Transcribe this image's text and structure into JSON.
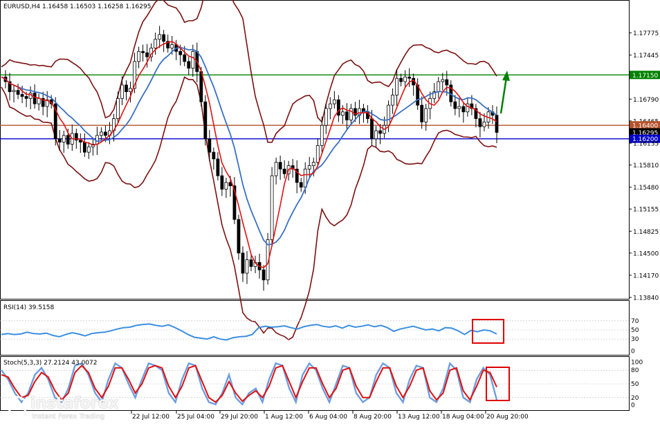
{
  "header": {
    "symbol_info": "EURUSD,H4  1.16458 1.16503 1.16258 1.16295"
  },
  "chart_data": {
    "type": "candlestick",
    "symbol": "EURUSD",
    "timeframe": "H4",
    "ohlc": {
      "open": 1.16458,
      "high": 1.16503,
      "low": 1.16258,
      "close": 1.16295
    },
    "ylim": [
      1.1384,
      1.181
    ],
    "y_ticks": [
      "1.17775",
      "1.17445",
      "1.17150",
      "1.16790",
      "1.16465",
      "1.16400",
      "1.16295",
      "1.16200",
      "1.16135",
      "1.15810",
      "1.15480",
      "1.15155",
      "1.14825",
      "1.14500",
      "1.14170",
      "1.13840"
    ],
    "x_ticks": [
      "22 Jul 12:00",
      "25 Jul 04:00",
      "29 Jul 20:00",
      "1 Aug 12:00",
      "6 Aug 04:00",
      "8 Aug 20:00",
      "13 Aug 12:00",
      "18 Aug 04:00",
      "20 Aug 20:00"
    ],
    "horizontal_levels": [
      {
        "price": 1.1715,
        "label": "1.17150",
        "color": "#008000"
      },
      {
        "price": 1.164,
        "label": "1.16400",
        "color": "#b5522a"
      },
      {
        "price": 1.162,
        "label": "1.16200",
        "color": "#0000cc"
      }
    ],
    "current_price_label": "1.16295",
    "close_path": [
      [
        0,
        1.1712
      ],
      [
        6,
        1.1705
      ],
      [
        12,
        1.169
      ],
      [
        18,
        1.1692
      ],
      [
        24,
        1.1686
      ],
      [
        30,
        1.1683
      ],
      [
        36,
        1.168
      ],
      [
        42,
        1.1688
      ],
      [
        48,
        1.1672
      ],
      [
        54,
        1.168
      ],
      [
        60,
        1.1668
      ],
      [
        66,
        1.1678
      ],
      [
        72,
        1.1672
      ],
      [
        78,
        1.162
      ],
      [
        84,
        1.1615
      ],
      [
        90,
        1.1625
      ],
      [
        96,
        1.1612
      ],
      [
        102,
        1.1628
      ],
      [
        108,
        1.1618
      ],
      [
        114,
        1.1615
      ],
      [
        120,
        1.16
      ],
      [
        126,
        1.1608
      ],
      [
        132,
        1.1612
      ],
      [
        138,
        1.1625
      ],
      [
        144,
        1.163
      ],
      [
        150,
        1.1625
      ],
      [
        156,
        1.1632
      ],
      [
        162,
        1.165
      ],
      [
        168,
        1.168
      ],
      [
        174,
        1.17
      ],
      [
        180,
        1.169
      ],
      [
        186,
        1.1695
      ],
      [
        192,
        1.1735
      ],
      [
        198,
        1.175
      ],
      [
        204,
        1.1748
      ],
      [
        210,
        1.1742
      ],
      [
        216,
        1.1755
      ],
      [
        222,
        1.1768
      ],
      [
        228,
        1.1775
      ],
      [
        234,
        1.1765
      ],
      [
        240,
        1.1755
      ],
      [
        246,
        1.176
      ],
      [
        252,
        1.175
      ],
      [
        258,
        1.1745
      ],
      [
        264,
        1.1735
      ],
      [
        270,
        1.1725
      ],
      [
        276,
        1.175
      ],
      [
        282,
        1.172
      ],
      [
        288,
        1.1675
      ],
      [
        294,
        1.162
      ],
      [
        300,
        1.16
      ],
      [
        306,
        1.159
      ],
      [
        312,
        1.1565
      ],
      [
        318,
        1.1545
      ],
      [
        324,
        1.1555
      ],
      [
        330,
        1.155
      ],
      [
        336,
        1.15
      ],
      [
        342,
        1.145
      ],
      [
        348,
        1.142
      ],
      [
        354,
        1.144
      ],
      [
        360,
        1.143
      ],
      [
        366,
        1.1436
      ],
      [
        372,
        1.1425
      ],
      [
        378,
        1.141
      ],
      [
        384,
        1.147
      ],
      [
        390,
        1.1565
      ],
      [
        396,
        1.1585
      ],
      [
        402,
        1.1575
      ],
      [
        408,
        1.1568
      ],
      [
        414,
        1.158
      ],
      [
        420,
        1.1575
      ],
      [
        426,
        1.1555
      ],
      [
        432,
        1.1548
      ],
      [
        438,
        1.1575
      ],
      [
        444,
        1.158
      ],
      [
        450,
        1.1585
      ],
      [
        456,
        1.161
      ],
      [
        462,
        1.164
      ],
      [
        468,
        1.1665
      ],
      [
        474,
        1.1672
      ],
      [
        480,
        1.1678
      ],
      [
        486,
        1.1655
      ],
      [
        492,
        1.166
      ],
      [
        498,
        1.1648
      ],
      [
        504,
        1.1665
      ],
      [
        510,
        1.1655
      ],
      [
        516,
        1.1665
      ],
      [
        522,
        1.166
      ],
      [
        528,
        1.165
      ],
      [
        534,
        1.162
      ],
      [
        540,
        1.1632
      ],
      [
        546,
        1.1628
      ],
      [
        552,
        1.164
      ],
      [
        558,
        1.167
      ],
      [
        564,
        1.1685
      ],
      [
        570,
        1.171
      ],
      [
        576,
        1.1705
      ],
      [
        582,
        1.1712
      ],
      [
        588,
        1.171
      ],
      [
        594,
        1.17
      ],
      [
        600,
        1.167
      ],
      [
        606,
        1.1645
      ],
      [
        612,
        1.1665
      ],
      [
        618,
        1.168
      ],
      [
        624,
        1.169
      ],
      [
        630,
        1.1705
      ],
      [
        636,
        1.1708
      ],
      [
        642,
        1.17
      ],
      [
        648,
        1.1675
      ],
      [
        654,
        1.1665
      ],
      [
        660,
        1.1668
      ],
      [
        666,
        1.166
      ],
      [
        672,
        1.1672
      ],
      [
        678,
        1.1665
      ],
      [
        684,
        1.165
      ],
      [
        690,
        1.1638
      ],
      [
        696,
        1.1645
      ],
      [
        702,
        1.166
      ],
      [
        708,
        1.1655
      ],
      [
        714,
        1.16295
      ]
    ],
    "rsi": {
      "label": "RSI(14) 39.5158",
      "period": 14,
      "value": 39.5158,
      "levels": [
        "70",
        "50",
        "30",
        "0"
      ],
      "values": [
        40,
        42,
        40,
        41,
        45,
        42,
        41,
        43,
        38,
        35,
        40,
        44,
        41,
        37,
        42,
        44,
        45,
        48,
        52,
        55,
        56,
        60,
        62,
        63,
        60,
        58,
        61,
        55,
        48,
        40,
        34,
        32,
        30,
        35,
        30,
        28,
        33,
        35,
        36,
        40,
        55,
        58,
        56,
        57,
        59,
        55,
        52,
        57,
        60,
        62,
        58,
        56,
        59,
        54,
        60,
        56,
        58,
        61,
        57,
        60,
        55,
        47,
        52,
        55,
        58,
        54,
        50,
        52,
        48,
        55,
        54,
        48,
        40,
        49,
        46,
        50,
        48,
        41
      ]
    },
    "stochastic": {
      "label": "Stoch(5,3,3) 27.2124 43.0072",
      "params": [
        5,
        3,
        3
      ],
      "main": 27.2124,
      "signal": 43.0072,
      "levels": [
        "100",
        "80",
        "50",
        "20",
        "0"
      ],
      "main_values": [
        80,
        60,
        30,
        10,
        30,
        70,
        85,
        60,
        20,
        10,
        40,
        90,
        95,
        70,
        30,
        10,
        60,
        95,
        85,
        50,
        20,
        60,
        95,
        90,
        80,
        30,
        10,
        60,
        95,
        90,
        40,
        10,
        5,
        30,
        70,
        20,
        5,
        30,
        40,
        10,
        60,
        95,
        90,
        40,
        10,
        70,
        95,
        80,
        40,
        10,
        50,
        90,
        85,
        30,
        10,
        20,
        70,
        95,
        85,
        30,
        10,
        60,
        90,
        85,
        20,
        10,
        40,
        95,
        80,
        20,
        10,
        60,
        85,
        70,
        15
      ],
      "signal_values": [
        70,
        65,
        40,
        20,
        25,
        55,
        75,
        65,
        35,
        15,
        30,
        75,
        90,
        75,
        40,
        20,
        45,
        85,
        85,
        60,
        30,
        50,
        85,
        90,
        85,
        45,
        20,
        45,
        85,
        90,
        55,
        20,
        10,
        25,
        55,
        30,
        12,
        25,
        35,
        20,
        45,
        85,
        90,
        55,
        20,
        55,
        85,
        85,
        50,
        20,
        40,
        80,
        85,
        45,
        20,
        20,
        55,
        85,
        85,
        45,
        20,
        45,
        80,
        85,
        35,
        15,
        30,
        80,
        85,
        35,
        15,
        45,
        80,
        75,
        43
      ]
    }
  },
  "watermark": {
    "brand": "instaforex",
    "tagline": "Instant Forex Trading"
  }
}
